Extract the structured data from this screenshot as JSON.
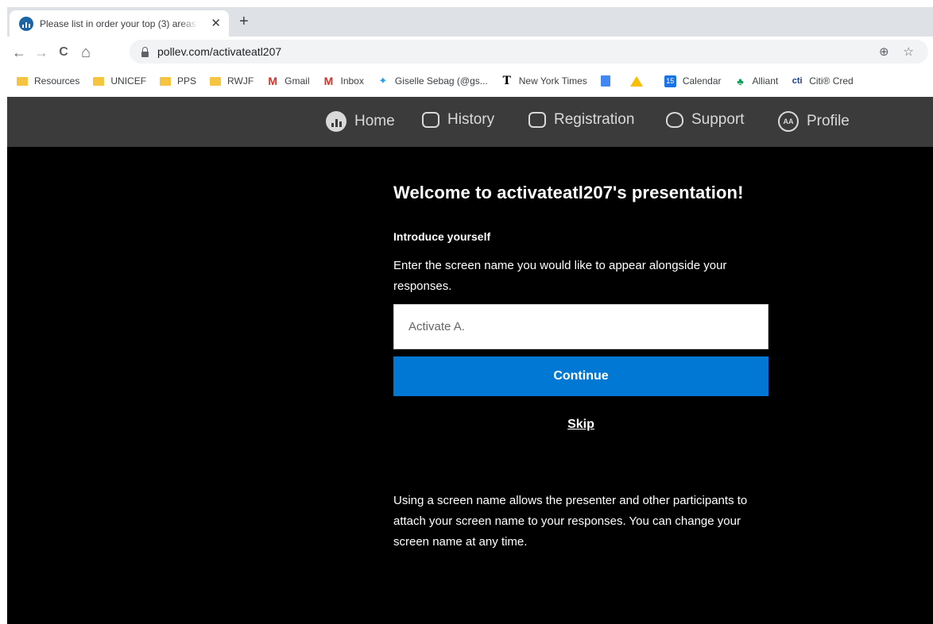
{
  "browser": {
    "tab": {
      "title": "Please list in order your top (3) areas",
      "close": "✕"
    },
    "new_tab": "+",
    "nav": {
      "back": "←",
      "forward": "→",
      "reload": "C",
      "home": "⌂"
    },
    "url": "pollev.com/activateatl207",
    "omni_icons": {
      "add": "⊕",
      "star": "☆"
    },
    "bookmarks": [
      {
        "label": "Resources",
        "icon": "folder-icon"
      },
      {
        "label": "UNICEF",
        "icon": "folder-icon"
      },
      {
        "label": "PPS",
        "icon": "folder-icon"
      },
      {
        "label": "RWJF",
        "icon": "folder-icon"
      },
      {
        "label": "Gmail",
        "icon": "gmail-icon",
        "glyph": "M"
      },
      {
        "label": "Inbox",
        "icon": "gmail-icon",
        "glyph": "M"
      },
      {
        "label": "Giselle Sebag (@gs...",
        "icon": "twitter-icon",
        "glyph": "🐦"
      },
      {
        "label": "New York Times",
        "icon": "nyt-icon",
        "glyph": "𝕿"
      },
      {
        "label": "",
        "icon": "docs-icon"
      },
      {
        "label": "",
        "icon": "drive-icon"
      },
      {
        "label": "Calendar",
        "icon": "calendar-icon",
        "glyph": "15"
      },
      {
        "label": "Alliant",
        "icon": "alliant-icon",
        "glyph": "♣"
      },
      {
        "label": "Citi® Cred",
        "icon": "citi-icon",
        "glyph": "cti"
      }
    ]
  },
  "app_nav": {
    "home": "Home",
    "history": "History",
    "registration": "Registration",
    "support": "Support",
    "profile": "Profile",
    "profile_initials": "AA"
  },
  "main": {
    "welcome": "Welcome to activateatl207's presentation!",
    "intro": "Introduce yourself",
    "description": "Enter the screen name you would like to appear alongside your responses.",
    "input_placeholder": "Activate A.",
    "continue": "Continue",
    "skip": "Skip",
    "footnote": "Using a screen name allows the presenter and other participants to attach your screen name to your responses. You can change your screen name at any time."
  },
  "colors": {
    "accent": "#0078d4",
    "nav_bg": "#3b3b3b",
    "page_bg": "#000000"
  }
}
